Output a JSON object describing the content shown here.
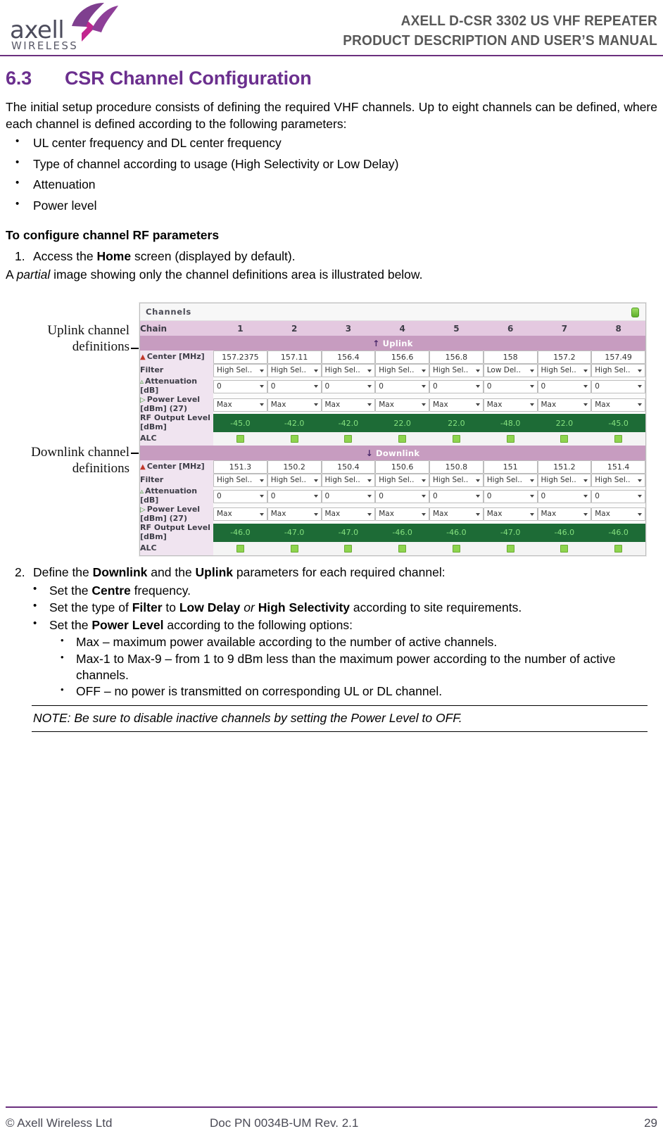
{
  "header": {
    "logo_text": "axell",
    "logo_sub": "WIRELESS",
    "title_line1": "AXELL D-CSR 3302 US VHF REPEATER",
    "title_line2": "PRODUCT DESCRIPTION AND USER’S MANUAL",
    "rule_color": "#6b2f7e"
  },
  "section": {
    "number": "6.3",
    "title": "CSR Channel Configuration",
    "intro": "The initial setup procedure consists of defining the required VHF channels. Up to eight channels can be defined, where each channel is defined according to the following parameters:",
    "param_bullets": [
      "UL center frequency and DL center frequency",
      "Type of channel according to usage (High Selectivity or Low Delay)",
      "Attenuation",
      "Power level"
    ],
    "procedure_heading": "To configure channel RF parameters",
    "step1_num": "1.",
    "step1_pre": "Access the ",
    "step1_bold": "Home",
    "step1_post": " screen (displayed by default).",
    "partial_pre": "A ",
    "partial_italic": "partial",
    "partial_post": " image showing only the channel definitions area is illustrated below."
  },
  "figure": {
    "callout_uplink_line1": "Uplink channel",
    "callout_uplink_line2": "definitions",
    "callout_downlink_line1": "Downlink channel",
    "callout_downlink_line2": "definitions"
  },
  "ui": {
    "panel_title": "Channels",
    "status_led": "green-led",
    "chain_label": "Chain",
    "chain_numbers": [
      "1",
      "2",
      "3",
      "4",
      "5",
      "6",
      "7",
      "8"
    ],
    "uplink_label": "Uplink",
    "downlink_label": "Downlink",
    "uplink_arrow": "↑",
    "downlink_arrow": "↓",
    "row_labels": {
      "center": "Center [MHz]",
      "filter": "Filter",
      "attenuation": "Attenuation [dB]",
      "attenuation_l1": "Attenuation",
      "attenuation_l2": "[dB]",
      "power": "Power Level",
      "power_l2": "[dBm] (27)",
      "rf_out_l1": "RF Output Level",
      "rf_out_l2": "[dBm]",
      "alc": "ALC"
    },
    "uplink": {
      "center": [
        "157.2375",
        "157.11",
        "156.4",
        "156.6",
        "156.8",
        "158",
        "157.2",
        "157.49"
      ],
      "filter": [
        "High Sel..",
        "High Sel..",
        "High Sel..",
        "High Sel..",
        "High Sel..",
        "Low Del..",
        "High Sel..",
        "High Sel.."
      ],
      "attenuation": [
        "0",
        "0",
        "0",
        "0",
        "0",
        "0",
        "0",
        "0"
      ],
      "power": [
        "Max",
        "Max",
        "Max",
        "Max",
        "Max",
        "Max",
        "Max",
        "Max"
      ],
      "rf_output": [
        "-45.0",
        "-42.0",
        "-42.0",
        "22.0",
        "22.0",
        "-48.0",
        "22.0",
        "-45.0"
      ],
      "alc": [
        "on",
        "on",
        "on",
        "on",
        "on",
        "on",
        "on",
        "on"
      ]
    },
    "downlink": {
      "center": [
        "151.3",
        "150.2",
        "150.4",
        "150.6",
        "150.8",
        "151",
        "151.2",
        "151.4"
      ],
      "filter": [
        "High Sel..",
        "High Sel..",
        "High Sel..",
        "High Sel..",
        "High Sel..",
        "High Sel..",
        "High Sel..",
        "High Sel.."
      ],
      "attenuation": [
        "0",
        "0",
        "0",
        "0",
        "0",
        "0",
        "0",
        "0"
      ],
      "power": [
        "Max",
        "Max",
        "Max",
        "Max",
        "Max",
        "Max",
        "Max",
        "Max"
      ],
      "rf_output": [
        "-46.0",
        "-47.0",
        "-47.0",
        "-46.0",
        "-46.0",
        "-47.0",
        "-46.0",
        "-46.0"
      ],
      "alc": [
        "on",
        "on",
        "on",
        "on",
        "on",
        "on",
        "on",
        "on"
      ]
    }
  },
  "step2": {
    "num": "2.",
    "pre": "Define the ",
    "b1": "Downlink",
    "mid": " and the ",
    "b2": "Uplink",
    "post": " parameters for each required channel:",
    "b_centre_pre": "Set the ",
    "b_centre_bold": "Centre",
    "b_centre_post": " frequency.",
    "b_filter_pre": "Set the type of ",
    "b_filter_b1": "Filter",
    "b_filter_mid": " to ",
    "b_filter_b2": "Low Delay",
    "b_filter_or": " or ",
    "b_filter_b3": "High Selectivity",
    "b_filter_post": " according to site requirements.",
    "b_power_pre": "Set the ",
    "b_power_bold": "Power Level",
    "b_power_post": " according to the following options:",
    "options": [
      "Max – maximum power available according to the number of active channels.",
      "Max-1 to Max-9 – from 1 to 9 dBm less than the maximum power according to the number of active channels.",
      "OFF – no power is transmitted on corresponding UL or DL channel."
    ],
    "note": "NOTE: Be sure to disable inactive channels by setting the Power Level to OFF."
  },
  "footer": {
    "left": "© Axell Wireless Ltd",
    "middle": "Doc PN 0034B-UM Rev. 2.1",
    "page": "29"
  }
}
